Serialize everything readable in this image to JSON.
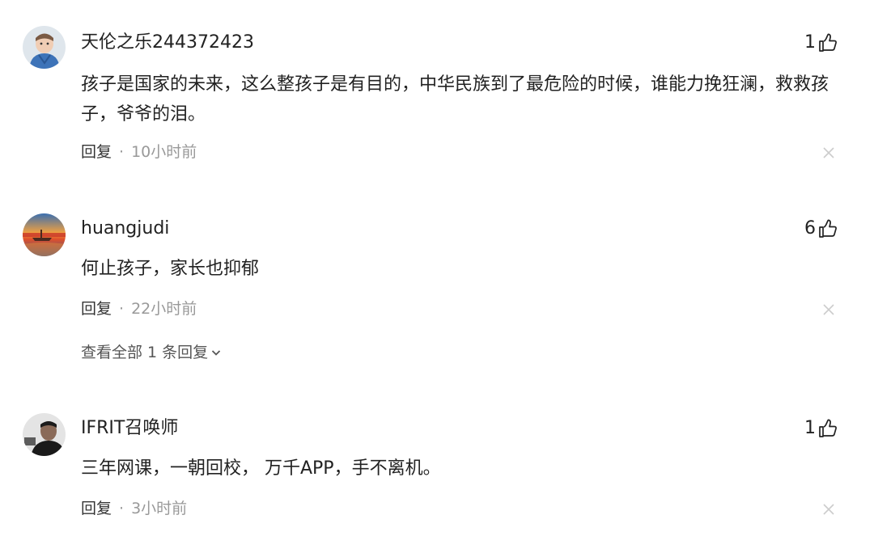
{
  "comments": [
    {
      "username": "天伦之乐244372423",
      "likes": "1",
      "content": "孩子是国家的未来，这么整孩子是有目的，中华民族到了最危险的时候，谁能力挽狂澜，救救孩子，爷爷的泪。",
      "reply_label": "回复",
      "separator": "·",
      "time": "10小时前",
      "avatar_icon": "child-photo-avatar"
    },
    {
      "username": "huangjudi",
      "likes": "6",
      "content": "何止孩子，家长也抑郁",
      "reply_label": "回复",
      "separator": "·",
      "time": "22小时前",
      "view_replies": "查看全部 1 条回复",
      "avatar_icon": "sunset-painting-avatar"
    },
    {
      "username": "IFRIT召唤师",
      "likes": "1",
      "content": "三年网课，一朝回校， 万千APP，手不离机。",
      "reply_label": "回复",
      "separator": "·",
      "time": "3小时前",
      "avatar_icon": "man-photo-avatar"
    }
  ],
  "icons": {
    "like": "thumbs-up-icon",
    "close": "close-icon",
    "expand": "chevron-down-icon"
  },
  "colors": {
    "text": "#222222",
    "muted": "#999999",
    "close": "#cccccc"
  }
}
